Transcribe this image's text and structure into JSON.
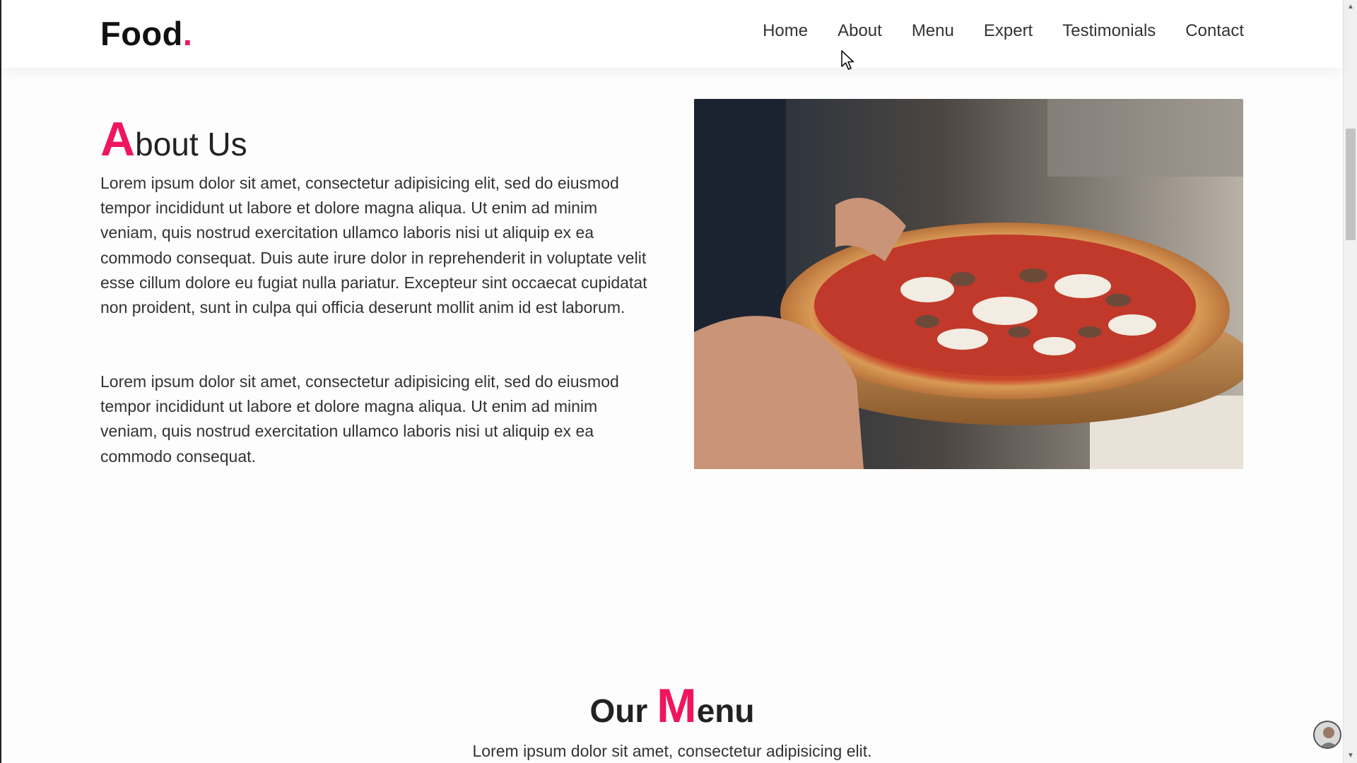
{
  "header": {
    "logo_text": "Food",
    "logo_dot": ".",
    "nav": [
      "Home",
      "About",
      "Menu",
      "Expert",
      "Testimonials",
      "Contact"
    ]
  },
  "about": {
    "title_cap": "A",
    "title_rest": "bout Us",
    "paragraph1": "Lorem ipsum dolor sit amet, consectetur adipisicing elit, sed do eiusmod tempor incididunt ut labore et dolore magna aliqua. Ut enim ad minim veniam, quis nostrud exercitation ullamco laboris nisi ut aliquip ex ea commodo consequat. Duis aute irure dolor in reprehenderit in voluptate velit esse cillum dolore eu fugiat nulla pariatur. Excepteur sint occaecat cupidatat non proident, sunt in culpa qui officia deserunt mollit anim id est laborum.",
    "paragraph2": "Lorem ipsum dolor sit amet, consectetur adipisicing elit, sed do eiusmod tempor incididunt ut labore et dolore magna aliqua. Ut enim ad minim veniam, quis nostrud exercitation ullamco laboris nisi ut aliquip ex ea commodo consequat."
  },
  "menu_section": {
    "title_pre": "Our ",
    "title_cap": "M",
    "title_rest": "enu",
    "subtitle": "Lorem ipsum dolor sit amet, consectetur adipisicing elit."
  },
  "colors": {
    "accent": "#f0155f"
  }
}
